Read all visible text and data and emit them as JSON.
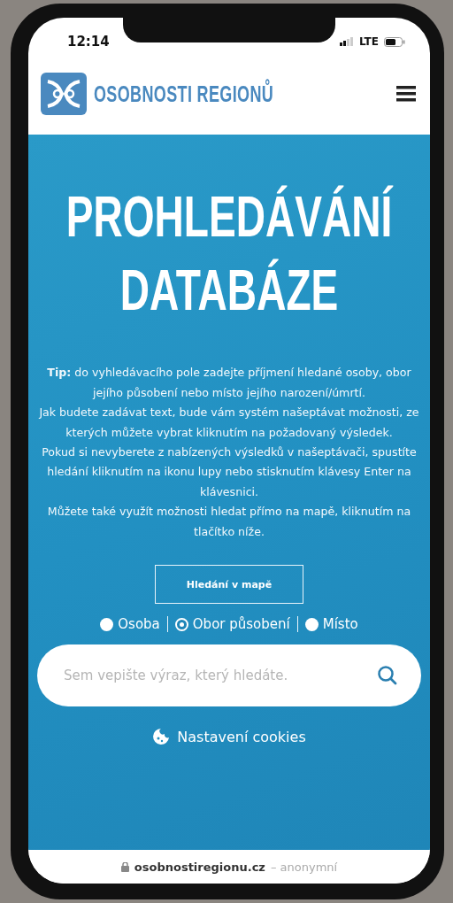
{
  "status_bar": {
    "time": "12:14",
    "network": "LTE"
  },
  "header": {
    "logo_text": "OSOBNOSTI REGIONŮ"
  },
  "hero": {
    "title_lines": [
      "PROHLEDÁVÁNÍ",
      "DATABÁZE"
    ],
    "paragraphs": [
      "**Tip:** do vyhledávacího pole zadejte příjmení hledané osoby, obor jejího působení nebo místo jejího narození/úmrtí.",
      "Jak budete zadávat text, bude vám systém našeptávat možnosti, ze kterých můžete vybrat kliknutím na požadovaný výsledek.",
      "Pokud si nevyberete z nabízených výsledků v našeptávači, spustíte hledání kliknutím na ikonu lupy nebo stisknutím klávesy Enter na klávesnici.",
      "Můžete také využít možnosti hledat přímo na mapě, kliknutím na tlačítko níže."
    ],
    "map_button": "Hledání v mapě",
    "search_types": [
      {
        "label": "Osoba",
        "selected": false
      },
      {
        "label": "Obor působení",
        "selected": true
      },
      {
        "label": "Místo",
        "selected": false
      }
    ],
    "search": {
      "placeholder": "Sem vepište výraz, který hledáte."
    },
    "cookies_link": "Nastavení cookies"
  },
  "address_bar": {
    "domain": "osobnostiregionu.cz",
    "mode": "– anonymní"
  }
}
